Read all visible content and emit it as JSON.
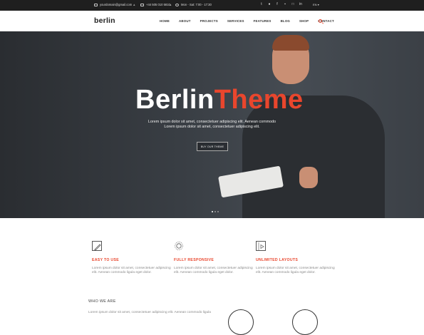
{
  "topbar": {
    "email": "yourdomain@gmail.com",
    "phone": "+44 505 010 5810",
    "hours": "Mon - Sat: 7:00 - 17:30",
    "social_icons": [
      "twitter-icon",
      "dribbble-icon",
      "facebook-icon",
      "flickr-icon",
      "instagram-icon",
      "linkedin-icon"
    ],
    "lang": "EN"
  },
  "header": {
    "logo": "berlin",
    "nav": [
      "HOME",
      "ABOUT",
      "PROJECTS",
      "SERVICES",
      "FEATURES",
      "BLOG",
      "SHOP",
      "CONTACT"
    ]
  },
  "hero": {
    "title_a": "Berlin",
    "title_b": "Theme",
    "subtitle_1": "Lorem ipsum dolor sit amet, consectetuer adipiscing elit. Aenean commodo",
    "subtitle_2": "Lorem ipsum dolor sit amet, consectetuer adipiscing elit.",
    "button": "BUY OUR THEME",
    "accent_color": "#e9462d"
  },
  "features": [
    {
      "icon": "pencil-icon",
      "title": "EASY TO USE",
      "text": "Lorem ipsum dolor sit amet, consectetuer adipiscing elit. Aenean commodo ligula eget dolor."
    },
    {
      "icon": "settings-icon",
      "title": "FULLY RESPONSIVE",
      "text": "Lorem ipsum dolor sit amet, consectetuer adipiscing elit. Aenean commodo ligula eget dolor."
    },
    {
      "icon": "video-icon",
      "title": "UNLIMITED LAYOUTS",
      "text": "Lorem ipsum dolor sit amet, consectetuer adipiscing elit. Aenean commodo ligula eget dolor."
    }
  ],
  "who": {
    "heading": "WHO WE ARE",
    "text": "Lorem ipsum dolor sit amet, consectetuer adipiscing elit. Aenean commodo ligula"
  }
}
